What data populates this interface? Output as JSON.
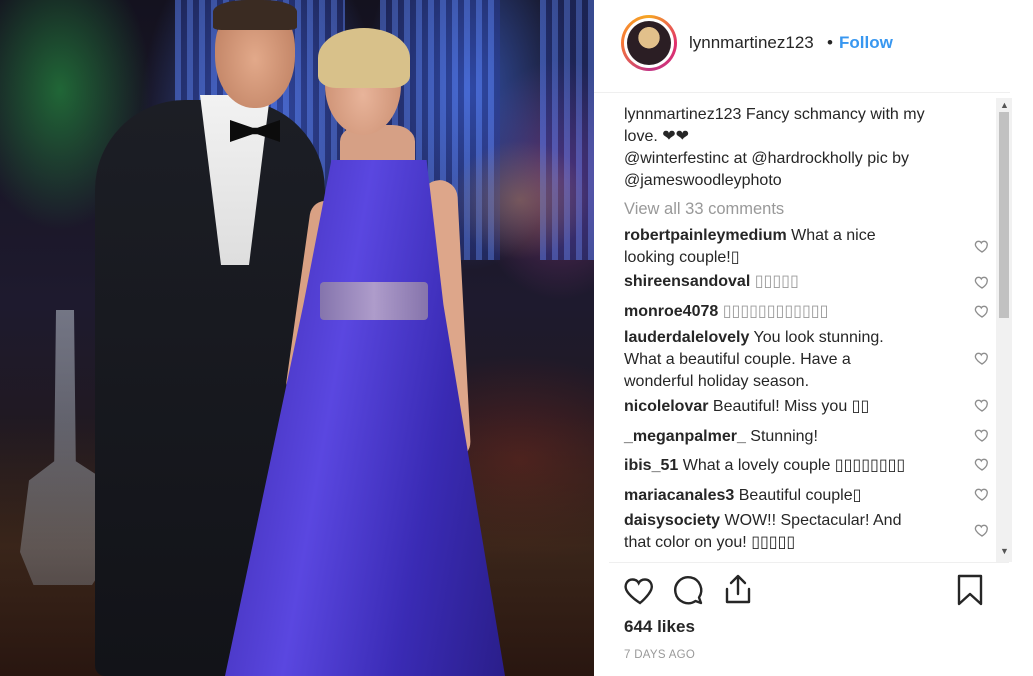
{
  "post": {
    "username": "lynnmartinez123",
    "separator": "•",
    "follow_label": "Follow",
    "caption_user": "lynnmartinez123",
    "caption_text_1": " Fancy schmancy with my",
    "caption_text_2": "love. ❤❤",
    "caption_line_3": "@winterfestinc at @hardrockholly pic by",
    "caption_line_4": "@jameswoodleyphoto",
    "view_all_label": "View all 33 comments",
    "likes": "644 likes",
    "time_ago": "7 DAYS AGO"
  },
  "comments": [
    {
      "user": "robertpainleymedium",
      "text_1": " What a nice",
      "text_2": "looking couple!▯"
    },
    {
      "user": "shireensandoval",
      "text_1": " ▯▯▯▯▯",
      "text_2": ""
    },
    {
      "user": "monroe4078",
      "text_1": " ▯▯▯▯▯▯▯▯▯▯▯▯",
      "text_2": ""
    },
    {
      "user": "lauderdalelovely",
      "text_1": " You look stunning.",
      "text_2": "What a beautiful couple. Have a",
      "text_3": "wonderful holiday season."
    },
    {
      "user": "nicolelovar",
      "text_1": " Beautiful! Miss you ▯▯",
      "text_2": ""
    },
    {
      "user": "_meganpalmer_",
      "text_1": " Stunning!",
      "text_2": ""
    },
    {
      "user": "ibis_51",
      "text_1": " What a lovely couple ▯▯▯▯▯▯▯▯",
      "text_2": ""
    },
    {
      "user": "mariacanales3",
      "text_1": " Beautiful couple▯",
      "text_2": ""
    },
    {
      "user": "daisysociety",
      "text_1": " WOW!! Spectacular! And",
      "text_2": "that color on you! ▯▯▯▯▯"
    }
  ],
  "icons": [
    "heart-icon",
    "comment-icon",
    "share-icon",
    "bookmark-icon"
  ],
  "colors": {
    "follow": "#3897f0",
    "text": "#262626",
    "muted": "#999999"
  }
}
